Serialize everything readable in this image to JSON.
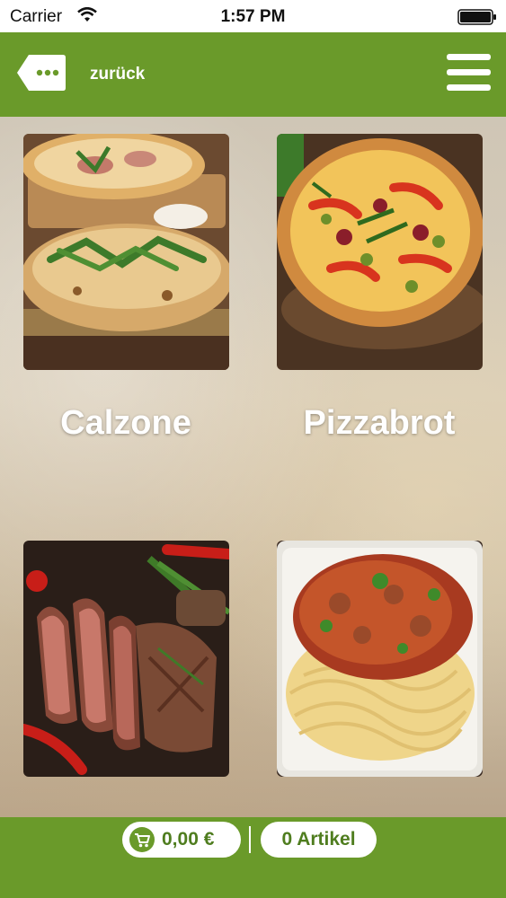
{
  "status_bar": {
    "carrier": "Carrier",
    "time": "1:57 PM"
  },
  "nav": {
    "back_label": "zurück",
    "accent_color": "#6a9a2a"
  },
  "categories": [
    {
      "label": "Calzone",
      "image": "calzone-photo"
    },
    {
      "label": "Pizzabrot",
      "image": "pizza-photo"
    },
    {
      "label": "",
      "image": "steak-photo"
    },
    {
      "label": "",
      "image": "spaghetti-bolognese-photo"
    }
  ],
  "cart": {
    "price": "0,00 €",
    "items": "0 Artikel"
  },
  "icons": {
    "back": "ellipsis-tag-icon",
    "menu": "hamburger-menu-icon",
    "cart": "shopping-cart-icon",
    "wifi": "wifi-icon",
    "battery": "battery-icon"
  }
}
